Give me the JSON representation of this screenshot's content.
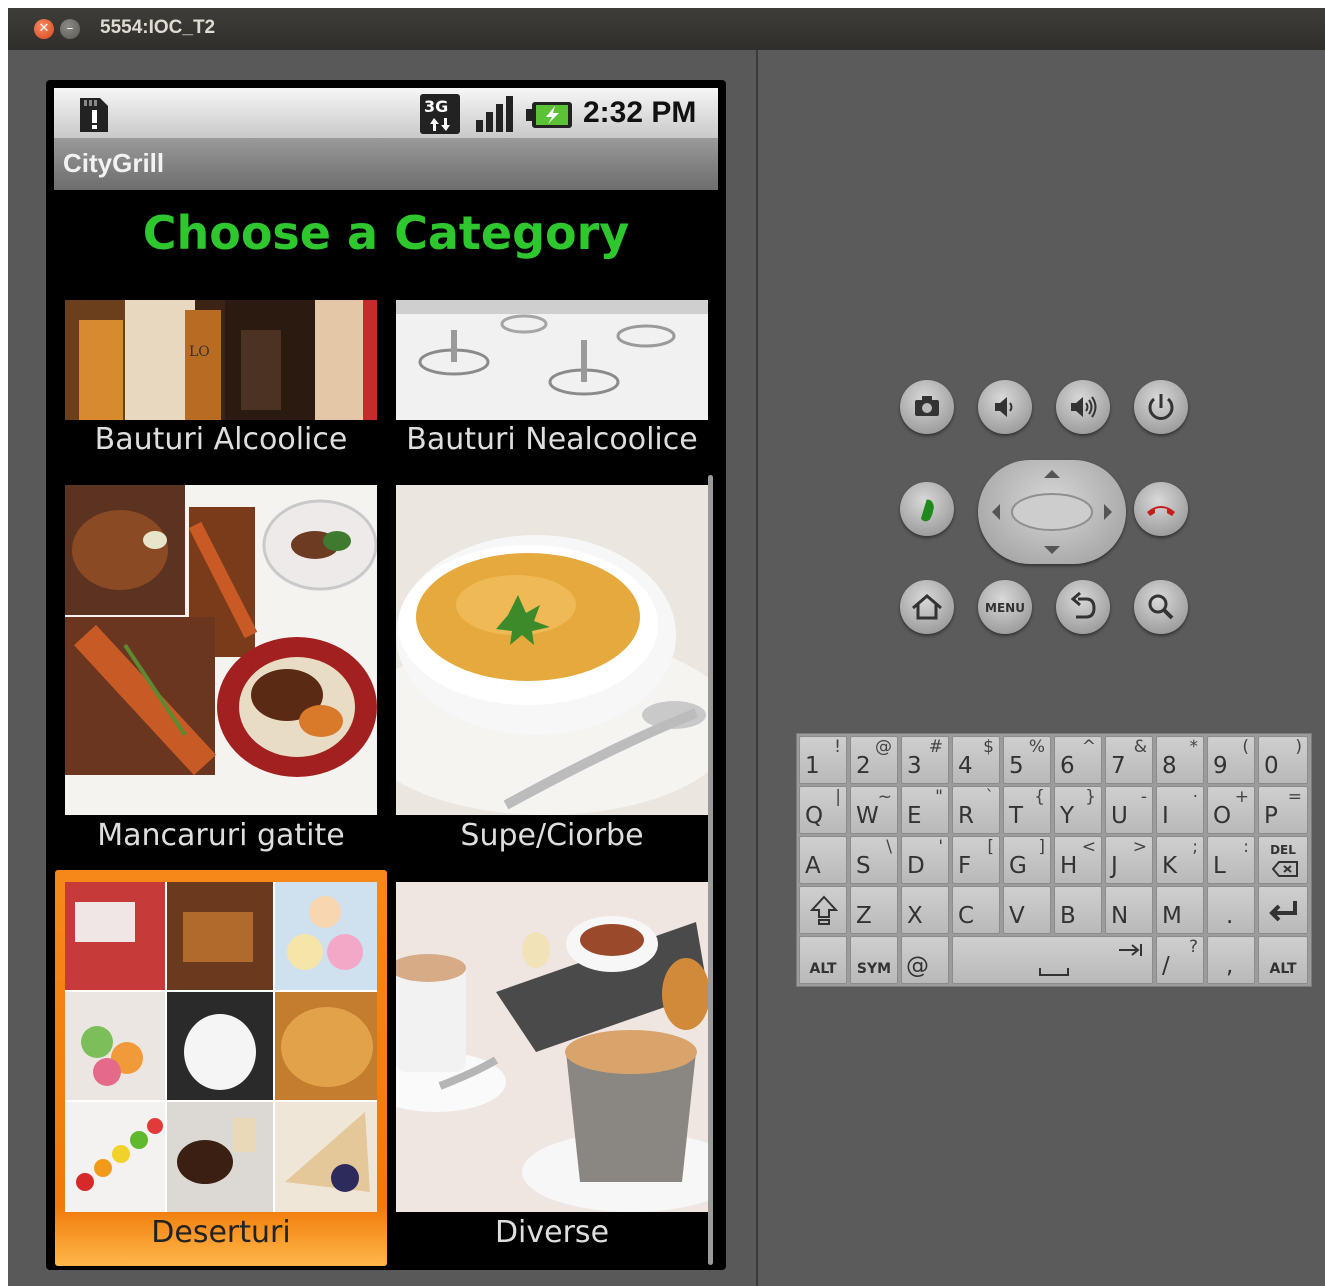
{
  "window": {
    "title": "5554:IOC_T2"
  },
  "status_bar": {
    "network": "3G",
    "time": "2:32 PM"
  },
  "app": {
    "title": "CityGrill",
    "heading": "Choose a Category"
  },
  "categories": [
    {
      "label": "Bauturi Alcoolice",
      "icon": "alcoholic-drinks-photo"
    },
    {
      "label": "Bauturi Nealcoolice",
      "icon": "glassware-photo"
    },
    {
      "label": "Mancaruri gatite",
      "icon": "cooked-dishes-photo"
    },
    {
      "label": "Supe/Ciorbe",
      "icon": "soup-bowl-photo"
    },
    {
      "label": "Deserturi",
      "icon": "desserts-collage-photo",
      "selected": true
    },
    {
      "label": "Diverse",
      "icon": "coffee-cups-photo"
    }
  ],
  "hardware_buttons": {
    "menu_label": "MENU",
    "icons": [
      "camera-icon",
      "volume-down-icon",
      "volume-up-icon",
      "power-icon",
      "call-icon",
      "dpad",
      "end-call-icon",
      "home-icon",
      "menu-button",
      "back-icon",
      "search-icon"
    ]
  },
  "keyboard": {
    "row1": [
      [
        "1",
        "!"
      ],
      [
        "2",
        "@"
      ],
      [
        "3",
        "#"
      ],
      [
        "4",
        "$"
      ],
      [
        "5",
        "%"
      ],
      [
        "6",
        "^"
      ],
      [
        "7",
        "&"
      ],
      [
        "8",
        "*"
      ],
      [
        "9",
        "("
      ],
      [
        "0",
        ")"
      ]
    ],
    "row2": [
      [
        "Q",
        "|"
      ],
      [
        "W",
        "~"
      ],
      [
        "E",
        "\""
      ],
      [
        "R",
        "`"
      ],
      [
        "T",
        "{"
      ],
      [
        "Y",
        "}"
      ],
      [
        "U",
        "-"
      ],
      [
        "I",
        "·"
      ],
      [
        "O",
        "+"
      ],
      [
        "P",
        "="
      ]
    ],
    "row3": [
      [
        "A",
        ""
      ],
      [
        "S",
        "\\"
      ],
      [
        "D",
        "'"
      ],
      [
        "F",
        "["
      ],
      [
        "G",
        "]"
      ],
      [
        "H",
        "<"
      ],
      [
        "J",
        ">"
      ],
      [
        "K",
        ";"
      ],
      [
        "L",
        ":"
      ]
    ],
    "row3_del": "DEL",
    "row4": [
      [
        "Z",
        ""
      ],
      [
        "X",
        ""
      ],
      [
        "C",
        ""
      ],
      [
        "V",
        ""
      ],
      [
        "B",
        ""
      ],
      [
        "N",
        ""
      ],
      [
        "M",
        ""
      ],
      [
        ".",
        ""
      ]
    ],
    "row5": {
      "alt_left": "ALT",
      "sym": "SYM",
      "at": "@",
      "slash": [
        "/",
        "?"
      ],
      "comma": ",",
      "alt_right": "ALT"
    }
  },
  "colors": {
    "heading": "#2ec72e",
    "selection": "#f07a0a",
    "window_bg": "#4b4b4b"
  }
}
